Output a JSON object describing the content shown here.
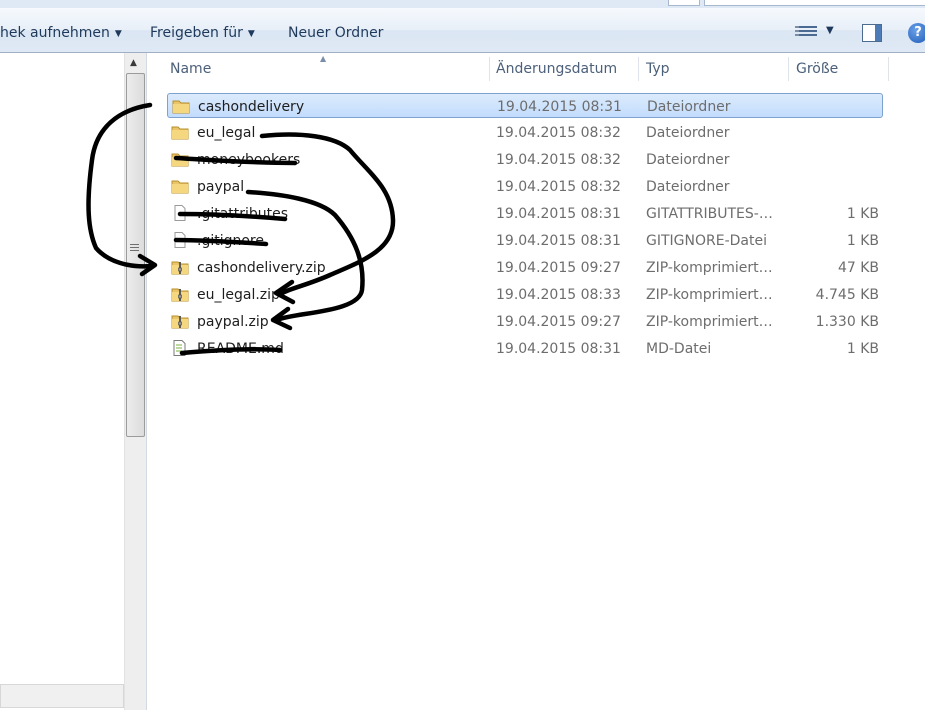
{
  "toolbar": {
    "library_label": "hek aufnehmen",
    "share_label": "Freigeben für",
    "new_folder_label": "Neuer Ordner",
    "view_icon": "details-view-icon",
    "preview_icon": "preview-pane-icon",
    "help_icon": "help-icon",
    "help_glyph": "?"
  },
  "columns": {
    "name": "Name",
    "date": "Änderungsdatum",
    "type": "Typ",
    "size": "Größe"
  },
  "files": [
    {
      "name": "cashondelivery",
      "date": "19.04.2015 08:31",
      "type": "Dateiordner",
      "size": "",
      "icon": "folder-icon",
      "selected": true
    },
    {
      "name": "eu_legal",
      "date": "19.04.2015 08:32",
      "type": "Dateiordner",
      "size": "",
      "icon": "folder-icon"
    },
    {
      "name": "moneybookers",
      "date": "19.04.2015 08:32",
      "type": "Dateiordner",
      "size": "",
      "icon": "folder-icon"
    },
    {
      "name": "paypal",
      "date": "19.04.2015 08:32",
      "type": "Dateiordner",
      "size": "",
      "icon": "folder-icon"
    },
    {
      "name": ".gitattributes",
      "date": "19.04.2015 08:31",
      "type": "GITATTRIBUTES-D...",
      "size": "1 KB",
      "icon": "file-icon"
    },
    {
      "name": ".gitignore",
      "date": "19.04.2015 08:31",
      "type": "GITIGNORE-Datei",
      "size": "1 KB",
      "icon": "file-icon"
    },
    {
      "name": "cashondelivery.zip",
      "date": "19.04.2015 09:27",
      "type": "ZIP-komprimierter...",
      "size": "47 KB",
      "icon": "zip-folder-icon"
    },
    {
      "name": "eu_legal.zip",
      "date": "19.04.2015 08:33",
      "type": "ZIP-komprimierter...",
      "size": "4.745 KB",
      "icon": "zip-folder-icon"
    },
    {
      "name": "paypal.zip",
      "date": "19.04.2015 09:27",
      "type": "ZIP-komprimierter...",
      "size": "1.330 KB",
      "icon": "zip-folder-icon"
    },
    {
      "name": "README.md",
      "date": "19.04.2015 08:31",
      "type": "MD-Datei",
      "size": "1 KB",
      "icon": "text-file-icon"
    }
  ]
}
